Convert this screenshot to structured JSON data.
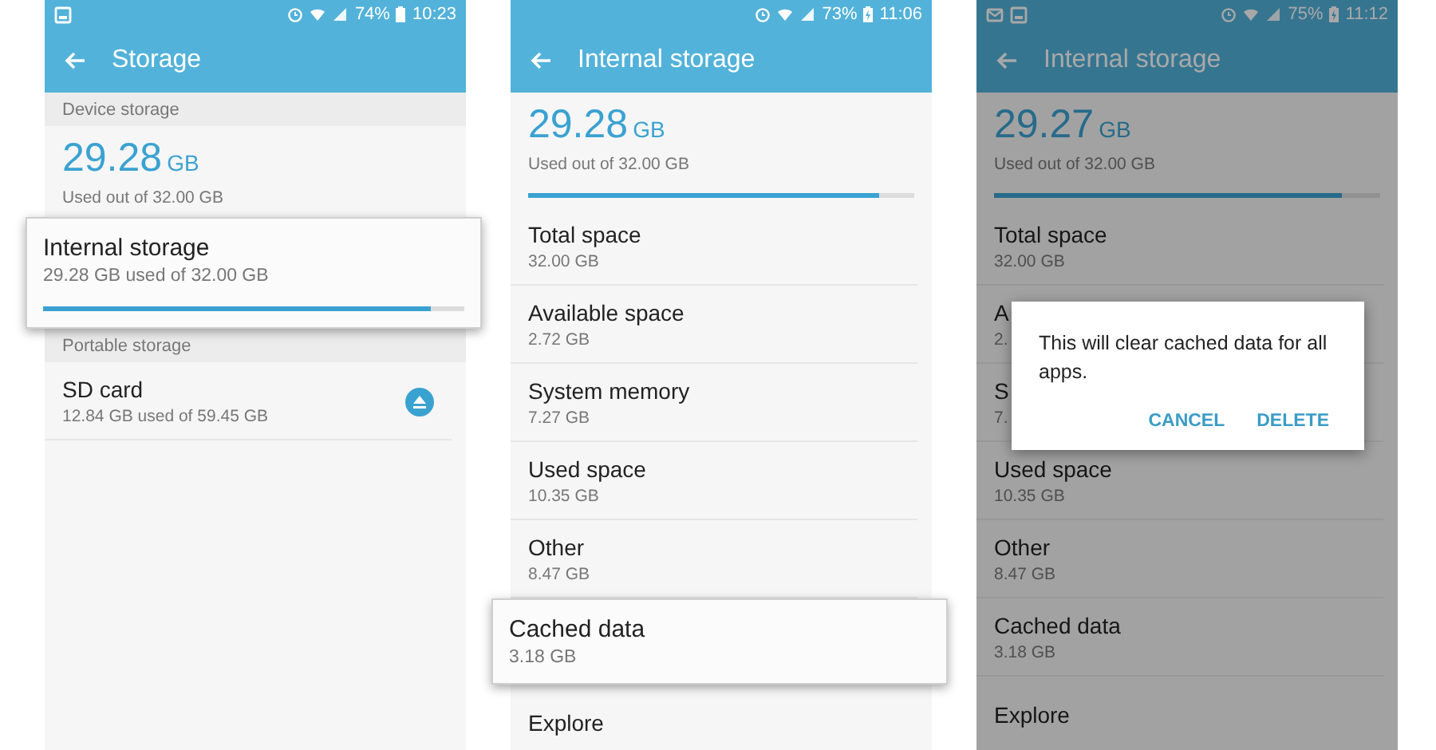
{
  "screens": [
    {
      "status": {
        "notification_icons": [
          {
            "kind": "image"
          }
        ],
        "battery": "74%",
        "charging": false,
        "time": "10:23"
      },
      "title": "Storage",
      "rows": [
        {
          "kind": "header",
          "text": "Device storage"
        },
        {
          "kind": "summary",
          "value": "29.28",
          "unit": "GB",
          "caption": "Used out of 32.00 GB"
        },
        {
          "kind": "item",
          "title": "Internal storage",
          "subtitle": "29.28 GB used of 32.00 GB",
          "level": 0.92,
          "ejectable": false,
          "highlighted": true
        },
        {
          "kind": "header",
          "text": "Portable storage"
        },
        {
          "kind": "item",
          "title": "SD card",
          "subtitle": "12.84 GB used of 59.45 GB",
          "ejectable": true,
          "highlighted": false
        }
      ]
    },
    {
      "status": {
        "battery": "73%",
        "charging": true,
        "time": "11:06"
      },
      "title": "Internal storage",
      "rows": [
        {
          "kind": "summary",
          "value": "29.28",
          "unit": "GB",
          "caption": "Used out of 32.00 GB",
          "level": 0.91
        },
        {
          "kind": "item",
          "title": "Total space",
          "subtitle": "32.00 GB",
          "highlighted": false
        },
        {
          "kind": "item",
          "title": "Available space",
          "subtitle": "2.72 GB",
          "highlighted": false
        },
        {
          "kind": "item",
          "title": "System memory",
          "subtitle": "7.27 GB",
          "highlighted": false
        },
        {
          "kind": "item",
          "title": "Used space",
          "subtitle": "10.35 GB",
          "highlighted": false
        },
        {
          "kind": "item",
          "title": "Other",
          "subtitle": "8.47 GB",
          "highlighted": false
        },
        {
          "kind": "item",
          "title": "Cached data",
          "subtitle": "3.18 GB",
          "highlighted": true
        },
        {
          "kind": "item",
          "title": "Explore",
          "highlighted": false
        }
      ]
    },
    {
      "status": {
        "notification_icons": [
          {
            "kind": "mail"
          },
          {
            "kind": "image"
          }
        ],
        "battery": "75%",
        "charging": true,
        "time": "11:12"
      },
      "title": "Internal storage",
      "rows": [
        {
          "kind": "summary",
          "value": "29.27",
          "unit": "GB",
          "caption": "Used out of 32.00 GB",
          "level": 0.9
        },
        {
          "kind": "item",
          "title": "Total space",
          "subtitle": "32.00 GB",
          "highlighted": false
        },
        {
          "kind": "item",
          "title": "A",
          "subtitle": "2.",
          "highlighted": false
        },
        {
          "kind": "item",
          "title": "S",
          "subtitle": "7.",
          "highlighted": false
        },
        {
          "kind": "item",
          "title": "Used space",
          "subtitle": "10.35 GB",
          "highlighted": false
        },
        {
          "kind": "item",
          "title": "Other",
          "subtitle": "8.47 GB",
          "highlighted": false
        },
        {
          "kind": "item",
          "title": "Cached data",
          "subtitle": "3.18 GB",
          "highlighted": false
        },
        {
          "kind": "item",
          "title": "Explore",
          "highlighted": false
        }
      ],
      "dialog": {
        "message": "This will clear cached data for all apps.",
        "buttons": [
          "CANCEL",
          "DELETE"
        ]
      }
    }
  ]
}
